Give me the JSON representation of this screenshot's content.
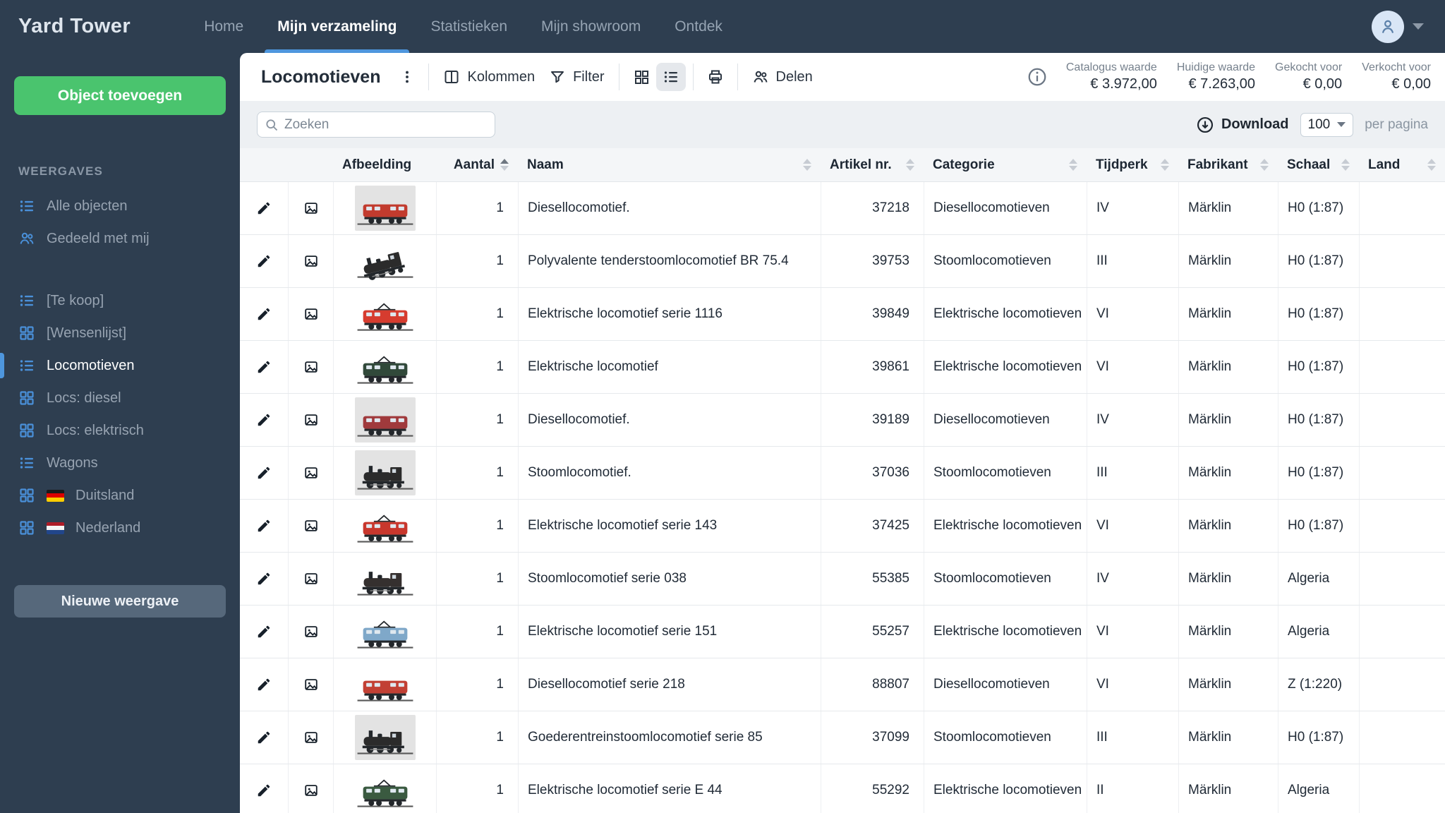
{
  "colors": {
    "navy": "#2e3e50",
    "accent_blue": "#4e96dd",
    "icon_blue": "#4a90d9",
    "green": "#4ac46e",
    "slate_button": "#56687b"
  },
  "nav": {
    "brand": "Yard Tower",
    "tabs": [
      {
        "label": "Home",
        "active": false
      },
      {
        "label": "Mijn verzameling",
        "active": true
      },
      {
        "label": "Statistieken",
        "active": false
      },
      {
        "label": "Mijn showroom",
        "active": false
      },
      {
        "label": "Ontdek",
        "active": false
      }
    ]
  },
  "sidebar": {
    "add_button": "Object toevoegen",
    "section_title": "WEERGAVES",
    "groups": [
      {
        "items": [
          {
            "label": "Alle objecten",
            "icon": "list",
            "active": false
          },
          {
            "label": "Gedeeld met mij",
            "icon": "people",
            "active": false
          }
        ]
      },
      {
        "items": [
          {
            "label": "[Te koop]",
            "icon": "list",
            "active": false
          },
          {
            "label": "[Wensenlijst]",
            "icon": "grid",
            "active": false
          },
          {
            "label": "Locomotieven",
            "icon": "list",
            "active": true
          },
          {
            "label": "Locs: diesel",
            "icon": "grid",
            "active": false
          },
          {
            "label": "Locs: elektrisch",
            "icon": "grid",
            "active": false
          },
          {
            "label": "Wagons",
            "icon": "list",
            "active": false
          },
          {
            "label": "Duitsland",
            "icon": "grid",
            "flag": "de",
            "active": false
          },
          {
            "label": "Nederland",
            "icon": "grid",
            "flag": "nl",
            "active": false
          }
        ]
      }
    ],
    "new_view_button": "Nieuwe weergave"
  },
  "toolbar": {
    "title": "Locomotieven",
    "kolommen_label": "Kolommen",
    "filter_label": "Filter",
    "delen_label": "Delen"
  },
  "stats": [
    {
      "label": "Catalogus waarde",
      "value": "€ 3.972,00"
    },
    {
      "label": "Huidige waarde",
      "value": "€ 7.263,00"
    },
    {
      "label": "Gekocht voor",
      "value": "€ 0,00"
    },
    {
      "label": "Verkocht voor",
      "value": "€ 0,00"
    }
  ],
  "controls": {
    "search_placeholder": "Zoeken",
    "download_label": "Download",
    "page_size": "100",
    "per_page_label": "per pagina"
  },
  "table": {
    "columns": [
      "Afbeelding",
      "Aantal",
      "Naam",
      "Artikel nr.",
      "Categorie",
      "Tijdperk",
      "Fabrikant",
      "Schaal",
      "Land"
    ],
    "rows": [
      {
        "aantal": "1",
        "naam": "Diesellocomotief.",
        "artikel": "37218",
        "categorie": "Diesellocomotieven",
        "tijdperk": "IV",
        "fabrikant": "Märklin",
        "schaal": "H0 (1:87)",
        "land": "",
        "image": {
          "type": "diesel",
          "color": "#c23b2e",
          "bg": "#e3e3e3"
        }
      },
      {
        "aantal": "1",
        "naam": "Polyvalente tenderstoomlocomotief BR 75.4",
        "artikel": "39753",
        "categorie": "Stoomlocomotieven",
        "tijdperk": "III",
        "fabrikant": "Märklin",
        "schaal": "H0 (1:87)",
        "land": "",
        "image": {
          "type": "steam",
          "color": "#2b2b2b",
          "bg": "#ffffff",
          "tilt": true
        }
      },
      {
        "aantal": "1",
        "naam": "Elektrische locomotief serie 1116",
        "artikel": "39849",
        "categorie": "Elektrische locomotieven",
        "tijdperk": "VI",
        "fabrikant": "Märklin",
        "schaal": "H0 (1:87)",
        "land": "",
        "image": {
          "type": "electric",
          "color": "#d63c2f",
          "bg": "#ffffff"
        }
      },
      {
        "aantal": "1",
        "naam": "Elektrische locomotief",
        "artikel": "39861",
        "categorie": "Elektrische locomotieven",
        "tijdperk": "VI",
        "fabrikant": "Märklin",
        "schaal": "H0 (1:87)",
        "land": "",
        "image": {
          "type": "electric",
          "color": "#31493a",
          "bg": "#ffffff"
        }
      },
      {
        "aantal": "1",
        "naam": "Diesellocomotief.",
        "artikel": "39189",
        "categorie": "Diesellocomotieven",
        "tijdperk": "IV",
        "fabrikant": "Märklin",
        "schaal": "H0 (1:87)",
        "land": "",
        "image": {
          "type": "diesel",
          "color": "#a03a3c",
          "bg": "#e3e3e3"
        }
      },
      {
        "aantal": "1",
        "naam": "Stoomlocomotief.",
        "artikel": "37036",
        "categorie": "Stoomlocomotieven",
        "tijdperk": "III",
        "fabrikant": "Märklin",
        "schaal": "H0 (1:87)",
        "land": "",
        "image": {
          "type": "steam",
          "color": "#2b2b2b",
          "bg": "#e3e3e3"
        }
      },
      {
        "aantal": "1",
        "naam": "Elektrische locomotief serie 143",
        "artikel": "37425",
        "categorie": "Elektrische locomotieven",
        "tijdperk": "VI",
        "fabrikant": "Märklin",
        "schaal": "H0 (1:87)",
        "land": "",
        "image": {
          "type": "electric",
          "color": "#c8372d",
          "bg": "#ffffff"
        }
      },
      {
        "aantal": "1",
        "naam": "Stoomlocomotief serie 038",
        "artikel": "55385",
        "categorie": "Stoomlocomotieven",
        "tijdperk": "IV",
        "fabrikant": "Märklin",
        "schaal": "Algeria",
        "land": "",
        "image": {
          "type": "steam",
          "color": "#35302f",
          "bg": "#ffffff"
        }
      },
      {
        "aantal": "1",
        "naam": "Elektrische locomotief serie 151",
        "artikel": "55257",
        "categorie": "Elektrische locomotieven",
        "tijdperk": "VI",
        "fabrikant": "Märklin",
        "schaal": "Algeria",
        "land": "",
        "image": {
          "type": "electric",
          "color": "#7fa8c9",
          "bg": "#ffffff"
        }
      },
      {
        "aantal": "1",
        "naam": "Diesellocomotief serie 218",
        "artikel": "88807",
        "categorie": "Diesellocomotieven",
        "tijdperk": "VI",
        "fabrikant": "Märklin",
        "schaal": "Z (1:220)",
        "land": "",
        "image": {
          "type": "diesel",
          "color": "#c24034",
          "bg": "#ffffff"
        }
      },
      {
        "aantal": "1",
        "naam": "Goederentreinstoomlocomotief serie 85",
        "artikel": "37099",
        "categorie": "Stoomlocomotieven",
        "tijdperk": "III",
        "fabrikant": "Märklin",
        "schaal": "H0 (1:87)",
        "land": "",
        "image": {
          "type": "steam",
          "color": "#2b2b2b",
          "bg": "#e3e3e3"
        }
      },
      {
        "aantal": "1",
        "naam": "Elektrische locomotief serie E 44",
        "artikel": "55292",
        "categorie": "Elektrische locomotieven",
        "tijdperk": "II",
        "fabrikant": "Märklin",
        "schaal": "Algeria",
        "land": "",
        "image": {
          "type": "electric",
          "color": "#3a5a40",
          "bg": "#ffffff"
        }
      }
    ]
  }
}
